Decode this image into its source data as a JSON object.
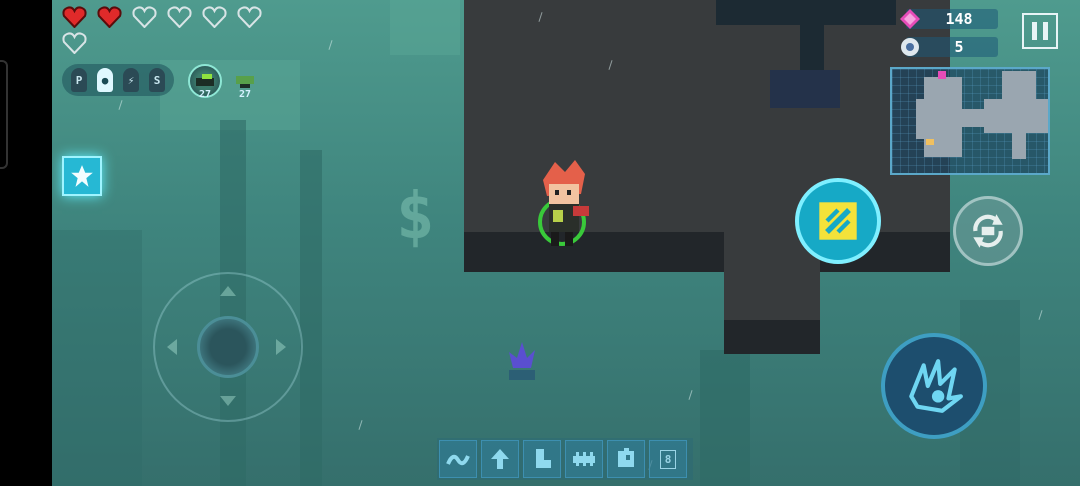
{
  "hud": {
    "hearts": {
      "total": 7,
      "full": 2
    },
    "currency": {
      "gems": "148",
      "cores": "5"
    },
    "buffs": [
      "P",
      "",
      "",
      "S"
    ],
    "followers": [
      {
        "icon": "turret-follower-icon",
        "count": "27"
      },
      {
        "icon": "drone-follower-icon",
        "count": "27"
      }
    ]
  },
  "hotbar": {
    "slots": [
      "wave-skill-icon",
      "arrow-up-icon",
      "boot-icon",
      "fence-icon",
      "puzzle-icon"
    ],
    "key_label": "8"
  },
  "colors": {
    "accent": "#16a9c6",
    "heart_full": "#e02a2a",
    "gem": "#e64cb8",
    "room": "#383b3d"
  }
}
